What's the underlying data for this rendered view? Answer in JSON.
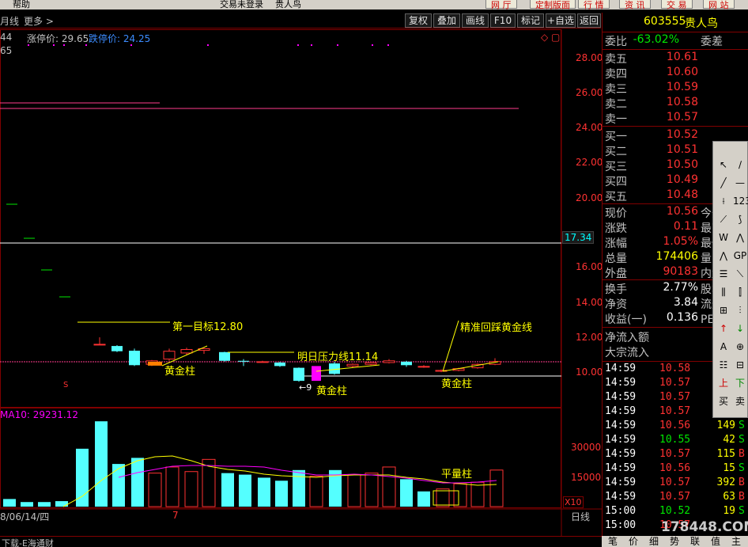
{
  "menubar": {
    "help": "帮助",
    "trade_status": "交易未登录",
    "stock_name": "贵人鸟",
    "buttons": [
      "网 厅",
      "定制版面",
      "行 情",
      "资 讯",
      "交 易",
      "网 站"
    ]
  },
  "toolbar": {
    "period": "月线",
    "more": "更多 >",
    "buttons": [
      "复权",
      "叠加",
      "画线",
      "F10",
      "标记",
      "+自选",
      "返回"
    ]
  },
  "chart": {
    "left_value_top": "44",
    "left_value_second": "65",
    "limit_up_label": "涨停价: 29.65",
    "limit_down_label": "跌停价: 24.25",
    "price_ticks": [
      "28.00",
      "26.00",
      "24.00",
      "22.00",
      "20.00",
      "16.00",
      "14.00",
      "12.00",
      "10.00"
    ],
    "current_price_tag": "17.34",
    "annotations": {
      "target1": "第一目标12.80",
      "pressure": "明日压力线11.14",
      "precise": "精准回踩黄金线",
      "gold1": "黄金柱",
      "gold2": "黄金柱",
      "gold3": "黄金柱",
      "flat": "平量柱",
      "small_arrow": "←9"
    },
    "volume_label": "MA10: 29231.12",
    "volume_ticks": [
      "30000",
      "15000"
    ],
    "volume_unit": "X10",
    "date_label": "8/06/14/四",
    "date_marker": "7",
    "period_label": "日线",
    "colors": {
      "up": "#ff3232",
      "down": "#54ffff",
      "ma_short": "#ffff00",
      "ma_long": "#ff00ff",
      "annotation": "#ffff00",
      "frame": "#800000"
    }
  },
  "quote": {
    "code": "603555",
    "name": "贵人鸟",
    "weibi_label": "委比",
    "weibi_value": "-63.02%",
    "weicha_label": "委差",
    "sells": [
      {
        "label": "卖五",
        "price": "10.61"
      },
      {
        "label": "卖四",
        "price": "10.60"
      },
      {
        "label": "卖三",
        "price": "10.59"
      },
      {
        "label": "卖二",
        "price": "10.58"
      },
      {
        "label": "卖一",
        "price": "10.57"
      }
    ],
    "buys": [
      {
        "label": "买一",
        "price": "10.52"
      },
      {
        "label": "买二",
        "price": "10.51"
      },
      {
        "label": "买三",
        "price": "10.50"
      },
      {
        "label": "买四",
        "price": "10.49"
      },
      {
        "label": "买五",
        "price": "10.48"
      }
    ],
    "stats": [
      {
        "label": "现价",
        "value": "10.56",
        "label2": "今开",
        "color": "red"
      },
      {
        "label": "涨跌",
        "value": "0.11",
        "label2": "最高",
        "color": "red"
      },
      {
        "label": "涨幅",
        "value": "1.05%",
        "label2": "最低",
        "color": "red"
      },
      {
        "label": "总量",
        "value": "174406",
        "label2": "量比",
        "color": "yel"
      },
      {
        "label": "外盘",
        "value": "90183",
        "label2": "内盘",
        "color": "red"
      }
    ],
    "stats2": [
      {
        "label": "换手",
        "value": "2.77%",
        "label2": "股本"
      },
      {
        "label": "净资",
        "value": "3.84",
        "label2": "流通"
      },
      {
        "label": "收益(一)",
        "value": "0.136",
        "label2": "PE(动)"
      }
    ],
    "flow": [
      "净流入额",
      "大宗流入"
    ],
    "ticks": [
      {
        "time": "14:59",
        "price": "10.58",
        "vol": "",
        "bs": ""
      },
      {
        "time": "14:59",
        "price": "10.57",
        "vol": "",
        "bs": ""
      },
      {
        "time": "14:59",
        "price": "10.57",
        "vol": "",
        "bs": ""
      },
      {
        "time": "14:59",
        "price": "10.57",
        "vol": "",
        "bs": ""
      },
      {
        "time": "14:59",
        "price": "10.56",
        "vol": "149",
        "bs": "S"
      },
      {
        "time": "14:59",
        "price": "10.55",
        "vol": "42",
        "bs": "S"
      },
      {
        "time": "14:59",
        "price": "10.57",
        "vol": "115",
        "bs": "B"
      },
      {
        "time": "14:59",
        "price": "10.56",
        "vol": "15",
        "bs": "S"
      },
      {
        "time": "14:59",
        "price": "10.57",
        "vol": "392",
        "bs": "B"
      },
      {
        "time": "14:59",
        "price": "10.57",
        "vol": "63",
        "bs": "B"
      },
      {
        "time": "15:00",
        "price": "10.52",
        "vol": "19",
        "bs": "S"
      },
      {
        "time": "15:00",
        "price": "10.57",
        "vol": "",
        "bs": ""
      }
    ],
    "bottom_tabs": [
      "笔",
      "价",
      "细",
      "势",
      "联",
      "值",
      "主"
    ]
  },
  "palette": {
    "icons": [
      "↖",
      "∕",
      "╱",
      "—",
      "⟊",
      "123",
      "⟋",
      "⟆",
      "W",
      "⋀",
      "⋀",
      "GP",
      "☰",
      "⟍",
      "⫼",
      "⫿",
      "⊞",
      "⫶",
      "↑",
      "↓",
      "A",
      "⊕",
      "☷",
      "⊟",
      "上",
      "下",
      "买",
      "卖"
    ]
  },
  "status": {
    "download": "下载-E海通财"
  },
  "watermark": "178448.COM"
}
